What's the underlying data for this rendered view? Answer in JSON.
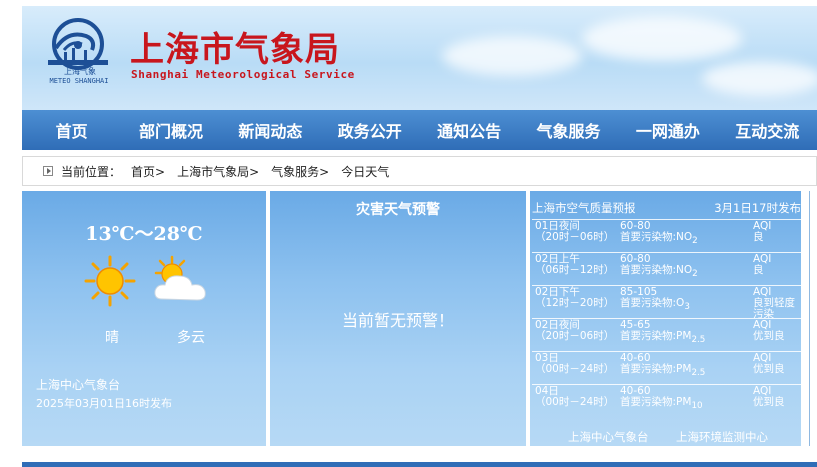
{
  "header": {
    "title": "上海市气象局",
    "subtitle": "Shanghai Meteorological Service",
    "logo_text_cn": "上海气象",
    "logo_text_en": "METEO SHANGHAI"
  },
  "nav": {
    "items": [
      {
        "label": "首页"
      },
      {
        "label": "部门概况"
      },
      {
        "label": "新闻动态"
      },
      {
        "label": "政务公开"
      },
      {
        "label": "通知公告"
      },
      {
        "label": "气象服务"
      },
      {
        "label": "一网通办"
      },
      {
        "label": "互动交流"
      }
    ]
  },
  "breadcrumb": {
    "label": "当前位置：",
    "items": [
      {
        "label": "首页>"
      },
      {
        "label": "上海市气象局>"
      },
      {
        "label": "气象服务>"
      },
      {
        "label": "今日天气"
      }
    ]
  },
  "weather": {
    "temp_range": "13℃～28℃",
    "day_condition": "晴",
    "night_condition": "多云",
    "day_icon": "sun-icon",
    "night_icon": "partly-cloudy-icon",
    "station": "上海中心气象台",
    "published": "2025年03月01日16时发布"
  },
  "warning": {
    "title": "灾害天气预警",
    "message": "当前暂无预警！"
  },
  "air_quality": {
    "title": "上海市空气质量预报",
    "published": "3月1日17时发布",
    "rows": [
      {
        "period": "01日夜间",
        "time": "（20时－06时）",
        "range": "60-80",
        "pollutant_label": "首要污染物:",
        "pollutant": "NO",
        "sub": "2",
        "aqi_label": "AQI",
        "aqi_level": "良"
      },
      {
        "period": "02日上午",
        "time": "（06时－12时）",
        "range": "60-80",
        "pollutant_label": "首要污染物:",
        "pollutant": "NO",
        "sub": "2",
        "aqi_label": "AQI",
        "aqi_level": "良"
      },
      {
        "period": "02日下午",
        "time": "（12时－20时）",
        "range": "85-105",
        "pollutant_label": "首要污染物:",
        "pollutant": "O",
        "sub": "3",
        "aqi_label": "AQI",
        "aqi_level": "良到轻度污染"
      },
      {
        "period": "02日夜间",
        "time": "（20时－06时）",
        "range": "45-65",
        "pollutant_label": "首要污染物:",
        "pollutant": "PM",
        "sub": "2.5",
        "aqi_label": "AQI",
        "aqi_level": "优到良"
      },
      {
        "period": "03日",
        "time": "（00时－24时）",
        "range": "40-60",
        "pollutant_label": "首要污染物:",
        "pollutant": "PM",
        "sub": "2.5",
        "aqi_label": "AQI",
        "aqi_level": "优到良"
      },
      {
        "period": "04日",
        "time": "（00时－24时）",
        "range": "40-60",
        "pollutant_label": "首要污染物:",
        "pollutant": "PM",
        "sub": "10",
        "aqi_label": "AQI",
        "aqi_level": "优到良"
      }
    ],
    "source_1": "上海中心气象台",
    "source_2": "上海环境监测中心"
  },
  "colors": {
    "title_red": "#c8161d",
    "nav_blue": "#2f6db7",
    "panel_blue": "#8dc1ef"
  }
}
